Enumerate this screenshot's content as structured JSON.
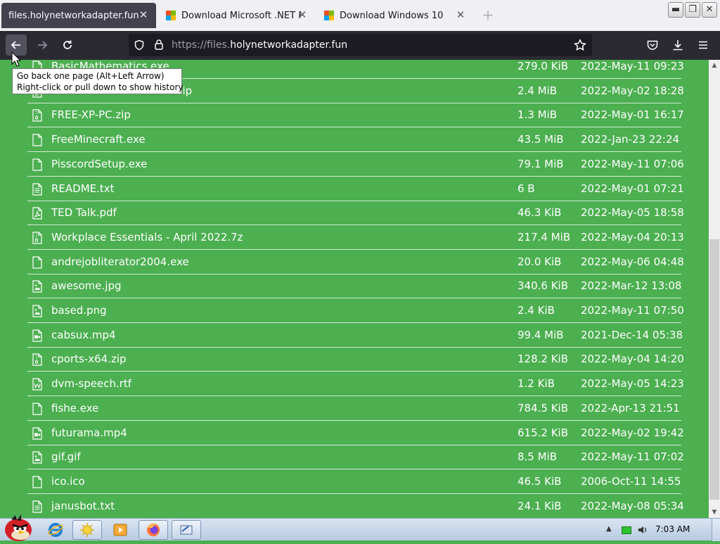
{
  "tabs": [
    {
      "label": "files.holynetworkadapter.fun",
      "active": true
    },
    {
      "label": "Download Microsoft .NET Fra",
      "active": false
    },
    {
      "label": "Download Windows 10",
      "active": false
    }
  ],
  "url": {
    "prefix": "https://files.",
    "domain": "holynetworkadapter.fun"
  },
  "tooltip": {
    "line1": "Go back one page (Alt+Left Arrow)",
    "line2": "Right-click or pull down to show history"
  },
  "files": [
    {
      "name": "BasicMathematics.exe",
      "size": "279.0 KiB",
      "date": "2022-May-11 09:23",
      "icon": "file-icon"
    },
    {
      "name": "FREE-ROBUX-minecraft.zip",
      "size": "2.4 MiB",
      "date": "2022-May-02 18:28",
      "icon": "archive-icon"
    },
    {
      "name": "FREE-XP-PC.zip",
      "size": "1.3 MiB",
      "date": "2022-May-01 16:17",
      "icon": "archive-icon"
    },
    {
      "name": "FreeMinecraft.exe",
      "size": "43.5 MiB",
      "date": "2022-Jan-23 22:24",
      "icon": "file-icon"
    },
    {
      "name": "PisscordSetup.exe",
      "size": "79.1 MiB",
      "date": "2022-May-11 07:06",
      "icon": "file-icon"
    },
    {
      "name": "README.txt",
      "size": "6 B",
      "date": "2022-May-01 07:21",
      "icon": "text-file-icon"
    },
    {
      "name": "TED Talk.pdf",
      "size": "46.3 KiB",
      "date": "2022-May-05 18:58",
      "icon": "pdf-file-icon"
    },
    {
      "name": "Workplace Essentials - April 2022.7z",
      "size": "217.4 MiB",
      "date": "2022-May-04 20:13",
      "icon": "archive-icon"
    },
    {
      "name": "andrejobliterator2004.exe",
      "size": "20.0 KiB",
      "date": "2022-May-06 04:48",
      "icon": "file-icon"
    },
    {
      "name": "awesome.jpg",
      "size": "340.6 KiB",
      "date": "2022-Mar-12 13:08",
      "icon": "image-file-icon"
    },
    {
      "name": "based.png",
      "size": "2.4 KiB",
      "date": "2022-May-11 07:50",
      "icon": "image-file-icon"
    },
    {
      "name": "cabsux.mp4",
      "size": "99.4 MiB",
      "date": "2021-Dec-14 05:38",
      "icon": "video-file-icon"
    },
    {
      "name": "cports-x64.zip",
      "size": "128.2 KiB",
      "date": "2022-May-04 14:20",
      "icon": "archive-icon"
    },
    {
      "name": "dvm-speech.rtf",
      "size": "1.2 KiB",
      "date": "2022-May-05 14:23",
      "icon": "word-file-icon"
    },
    {
      "name": "fishe.exe",
      "size": "784.5 KiB",
      "date": "2022-Apr-13 21:51",
      "icon": "file-icon"
    },
    {
      "name": "futurama.mp4",
      "size": "615.2 KiB",
      "date": "2022-May-02 19:42",
      "icon": "video-file-icon"
    },
    {
      "name": "gif.gif",
      "size": "8.5 MiB",
      "date": "2022-May-11 07:02",
      "icon": "image-file-icon"
    },
    {
      "name": "ico.ico",
      "size": "46.5 KiB",
      "date": "2006-Oct-11 14:55",
      "icon": "file-icon"
    },
    {
      "name": "janusbot.txt",
      "size": "24.1 KiB",
      "date": "2022-May-08 05:34",
      "icon": "text-file-icon"
    }
  ],
  "taskbar": {
    "clock": "7:03 AM"
  }
}
